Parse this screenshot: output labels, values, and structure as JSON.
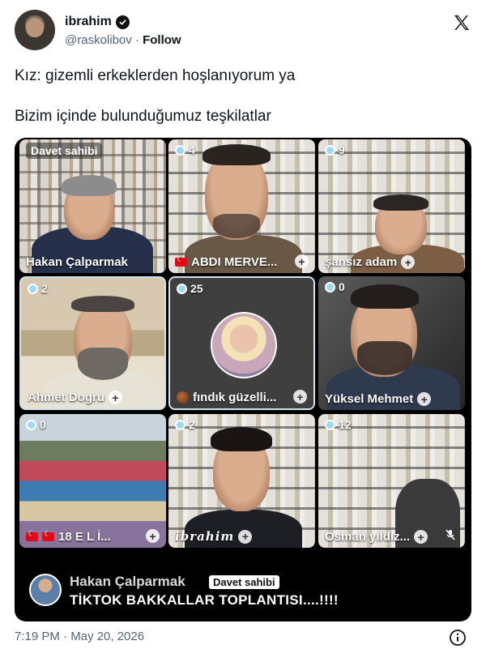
{
  "author": {
    "display_name": "ibrahim",
    "handle": "@raskolibov",
    "follow_label": "Follow",
    "verified": true
  },
  "tweet": {
    "line1": "Kız: gizemli erkeklerden hoşlanıyorum ya",
    "line2": "Bizim içinde bulunduğumuz teşkilatlar"
  },
  "media": {
    "tiles": [
      {
        "host_badge": "Davet sahibi",
        "count": "",
        "name": "Hakan Çalparmak"
      },
      {
        "count": "4",
        "name": "ABDI MERVE..."
      },
      {
        "count": "9",
        "name": "şansız adam"
      },
      {
        "count": "2",
        "name": "Ahmet Dogru"
      },
      {
        "count": "25",
        "name": "fındık güzelli..."
      },
      {
        "count": "0",
        "name": "Yüksel Mehmet"
      },
      {
        "count": "0",
        "name": "18 E L İ..."
      },
      {
        "count": "2",
        "name": "ibrahim"
      },
      {
        "count": "12",
        "name": "Osman yıldız..."
      }
    ],
    "caption": {
      "name": "Hakan Çalparmak",
      "host_label": "Davet sahibi",
      "title": "TİKTOK BAKKALLAR TOPLANTISI....!!!!"
    }
  },
  "footer": {
    "timestamp": "7:19 PM · May 20, 2026"
  },
  "icons": {
    "brand": "x-logo-icon",
    "info": "info-icon",
    "verified": "verified-badge-icon"
  },
  "colors": {
    "text_primary": "#0f1419",
    "text_secondary": "#536471",
    "media_bg": "#000000",
    "viewer_icon": "#9fd8f5"
  }
}
